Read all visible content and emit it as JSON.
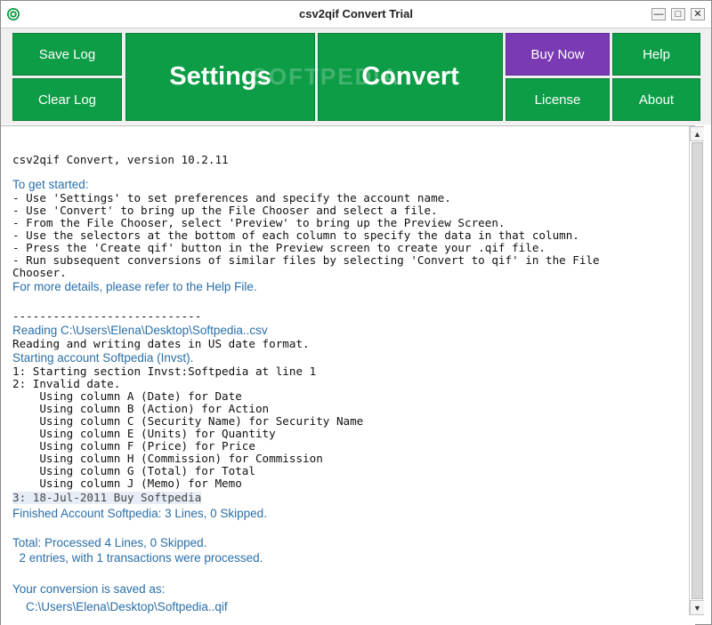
{
  "window": {
    "title": "csv2qif Convert Trial",
    "minimize_glyph": "—",
    "maximize_glyph": "□",
    "close_glyph": "✕"
  },
  "toolbar": {
    "save_log": "Save Log",
    "clear_log": "Clear Log",
    "settings": "Settings",
    "convert": "Convert",
    "buy_now": "Buy Now",
    "help": "Help",
    "license": "License",
    "about": "About",
    "watermark": "SOFTPEDIA"
  },
  "colors": {
    "green": "#0d9d46",
    "purple": "#7a3ab3",
    "log_blue": "#2a6fa8"
  },
  "log": {
    "version": "csv2qif Convert, version 10.2.11",
    "get_started": "To get started:",
    "steps": [
      "- Use 'Settings' to set preferences and specify the account name.",
      "- Use 'Convert' to bring up the File Chooser and select a file.",
      "- From the File Chooser, select 'Preview' to bring up the Preview Screen.",
      "- Use the selectors at the bottom of each column to specify the data in that column.",
      "- Press the 'Create qif' button in the Preview screen to create your .qif file.",
      "- Run subsequent conversions of similar files by selecting 'Convert to qif' in the File",
      "Chooser."
    ],
    "more_details": "For more details, please refer to the Help File.",
    "separator": "----------------------------",
    "reading": "Reading C:\\Users\\Elena\\Desktop\\Softpedia..csv",
    "date_format": "Reading and writing dates in US date format.",
    "starting_account": "Starting account Softpedia (Invst).",
    "section_line": "1: Starting section Invst:Softpedia at line 1",
    "invalid_date": "2: Invalid date.",
    "columns": [
      "    Using column A (Date) for Date",
      "    Using column B (Action) for Action",
      "    Using column C (Security Name) for Security Name",
      "    Using column E (Units) for Quantity",
      "    Using column F (Price) for Price",
      "    Using column H (Commission) for Commission",
      "    Using column G (Total) for Total",
      "    Using column J (Memo) for Memo"
    ],
    "buy_line": "3: 18-Jul-2011 Buy Softpedia",
    "finished": "Finished Account Softpedia: 3 Lines, 0 Skipped.",
    "total": "Total: Processed 4 Lines, 0 Skipped.",
    "entries": "  2 entries, with 1 transactions were processed.",
    "saved_as": "Your conversion is saved as:",
    "output_path": "    C:\\Users\\Elena\\Desktop\\Softpedia..qif"
  },
  "scrollbar": {
    "up_glyph": "▲",
    "down_glyph": "▼"
  }
}
